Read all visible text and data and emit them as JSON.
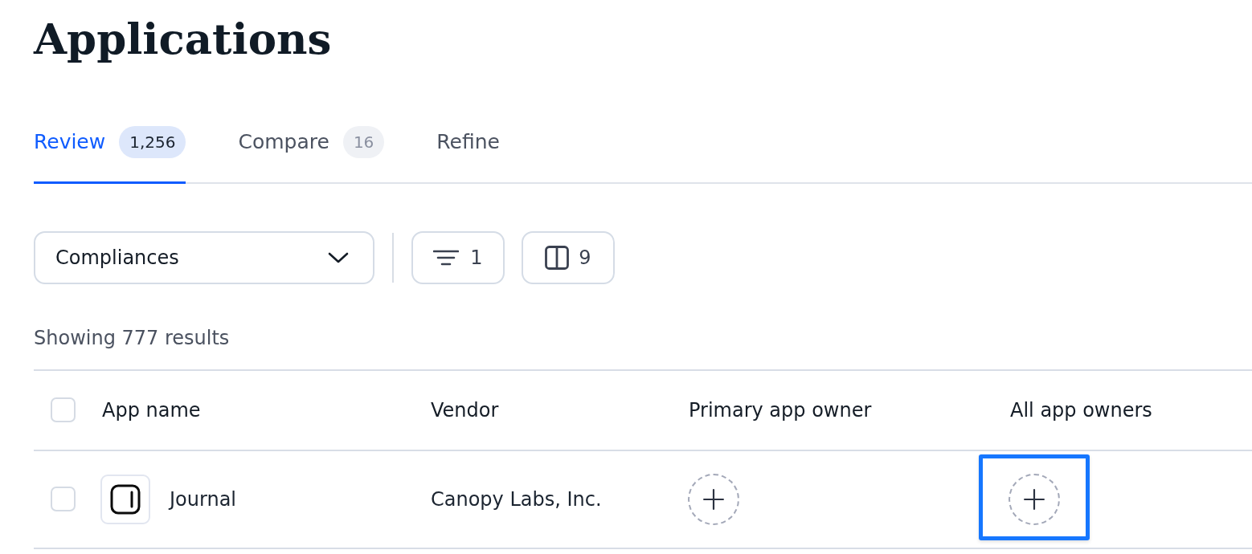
{
  "page": {
    "title": "Applications"
  },
  "tabs": [
    {
      "label": "Review",
      "count": "1,256",
      "selected": true
    },
    {
      "label": "Compare",
      "count": "16",
      "selected": false
    },
    {
      "label": "Refine",
      "selected": false
    }
  ],
  "toolbar": {
    "dropdown": {
      "value": "Compliances"
    },
    "filter_button": {
      "label": "1"
    },
    "columns_button": {
      "label": "9"
    }
  },
  "results_text": "Showing 777 results",
  "table": {
    "select_all": {
      "checked": false
    },
    "columns": [
      "App name",
      "Vendor",
      "Primary app owner",
      "All app owners"
    ],
    "rows": [
      {
        "checked": false,
        "app_name": "Journal",
        "vendor": "Canopy Labs, Inc.",
        "primary_owner": {
          "focused": false
        },
        "all_owners": {
          "focused": true
        }
      }
    ]
  }
}
